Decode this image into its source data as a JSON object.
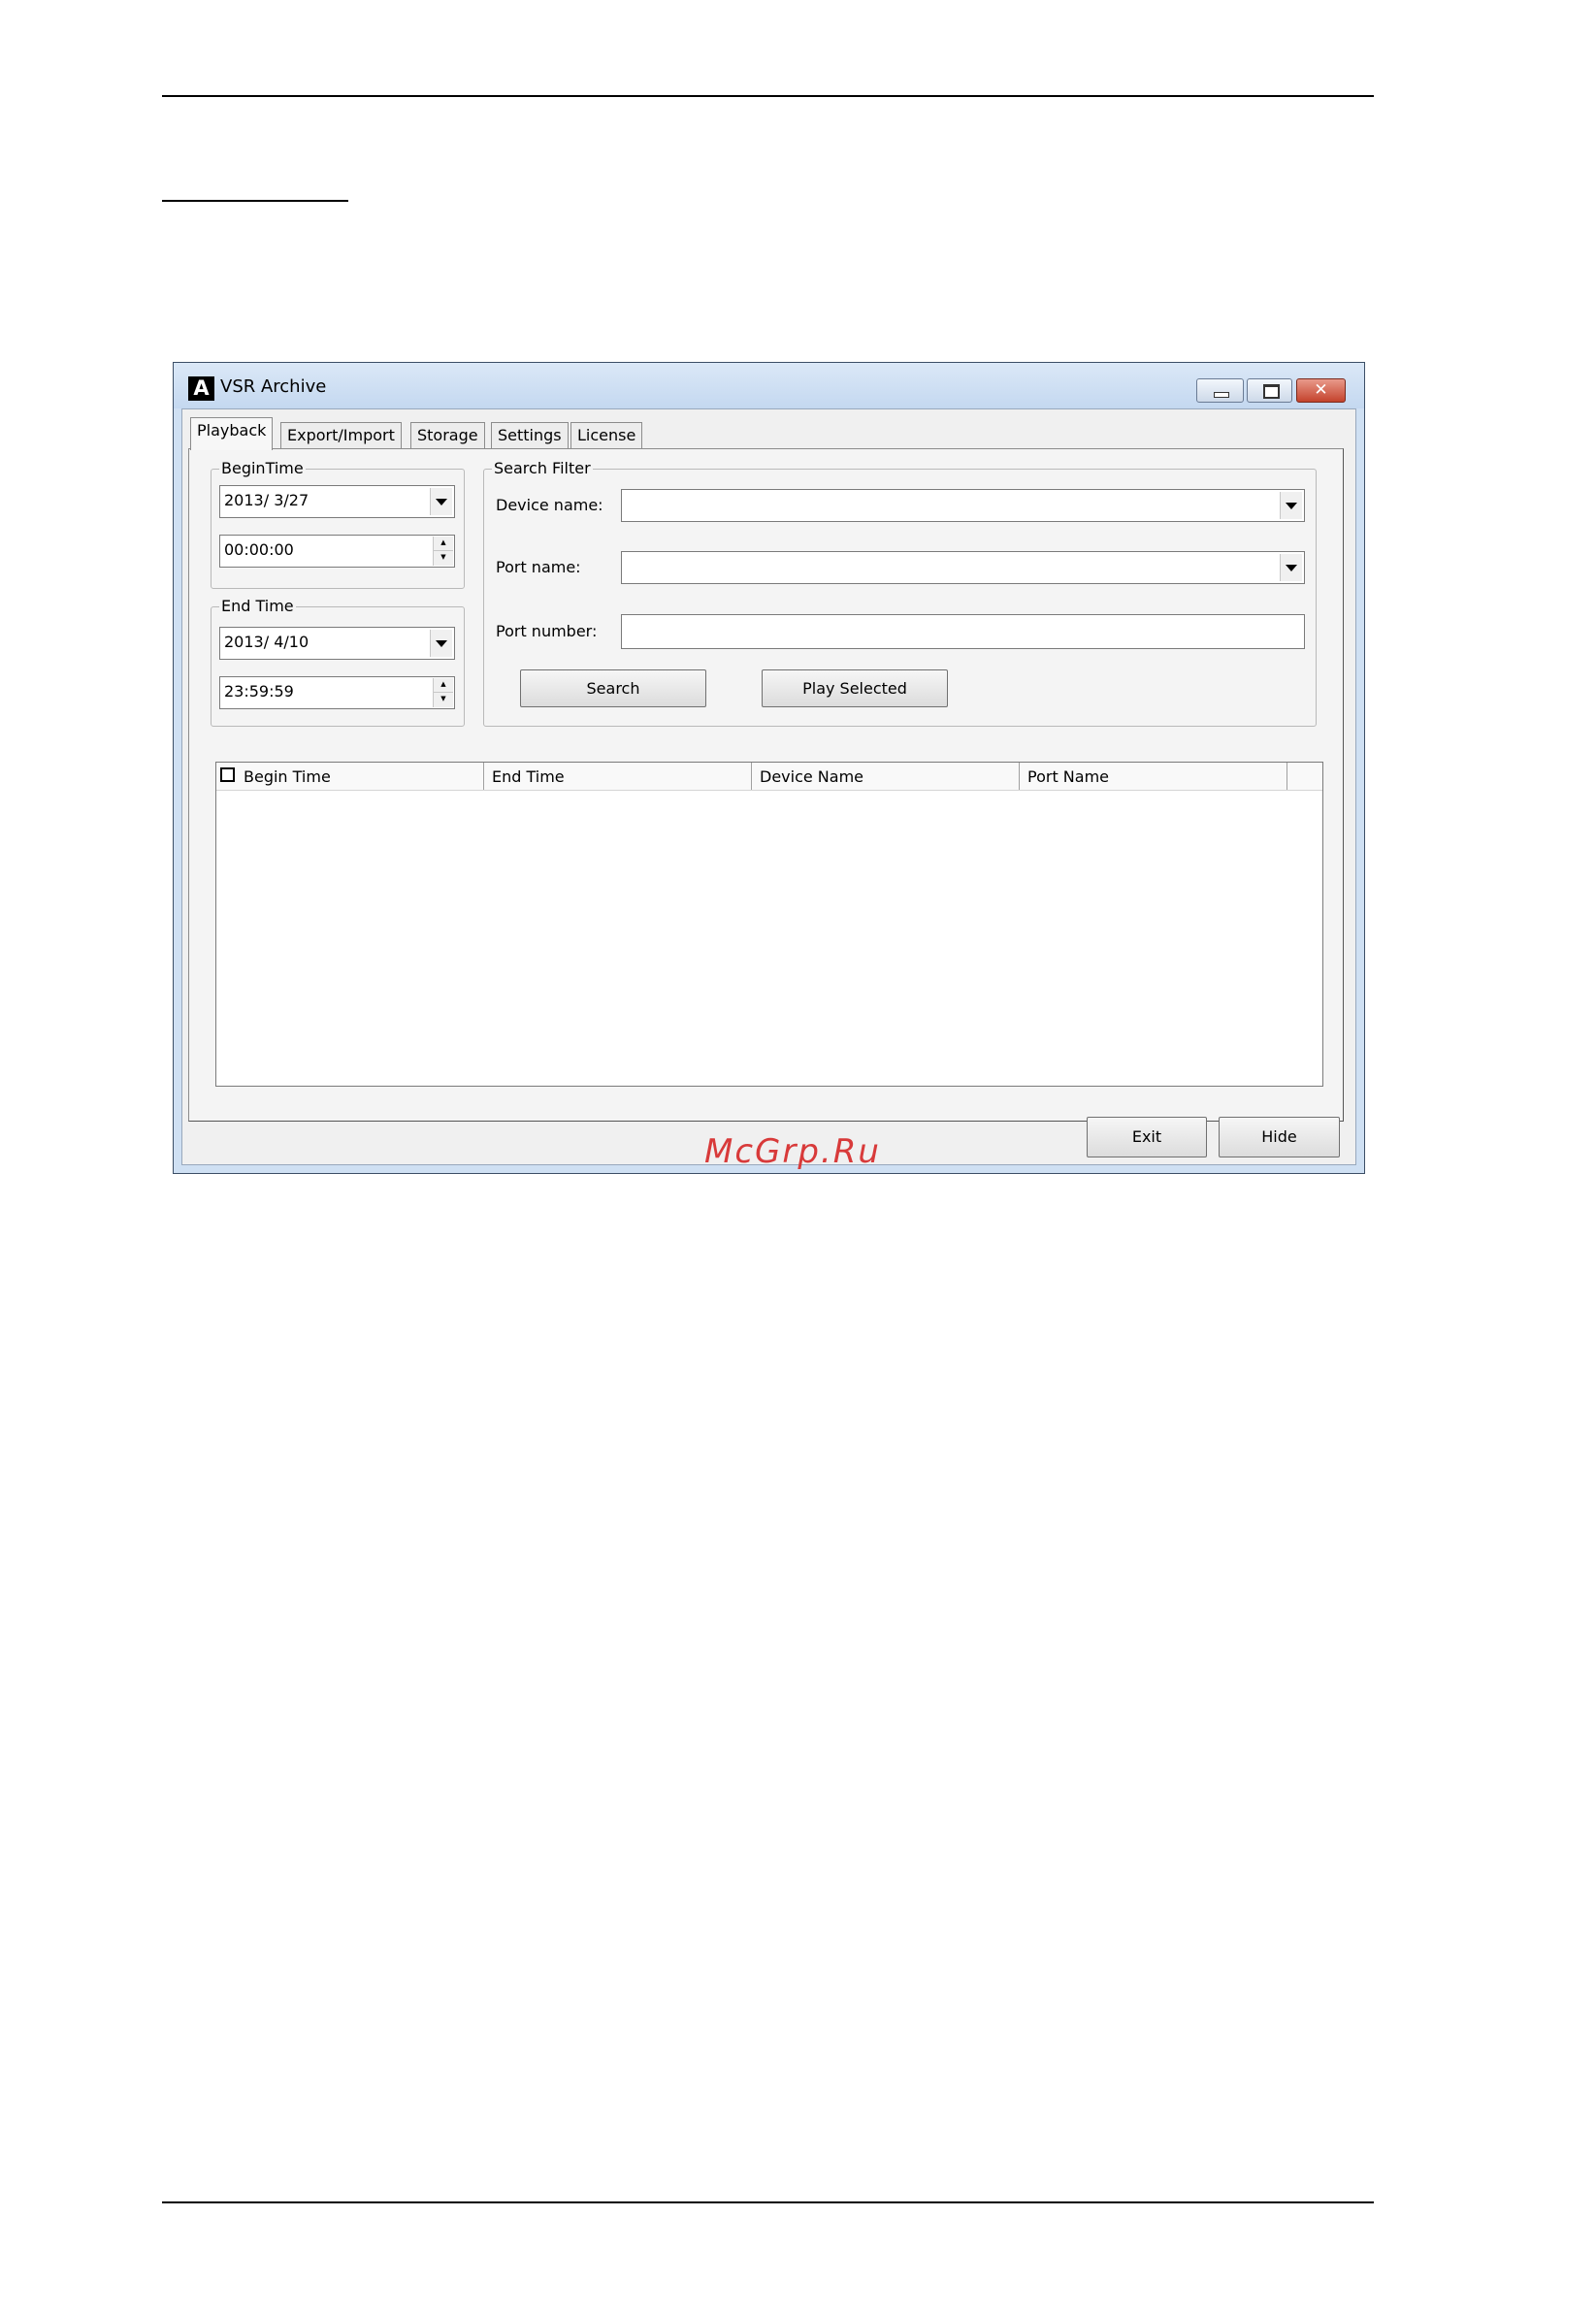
{
  "window": {
    "title": "VSR Archive",
    "logo_letter": "A",
    "controls": {
      "minimize": "minimize",
      "maximize": "maximize",
      "close": "✕"
    }
  },
  "tabs": [
    {
      "label": "Playback",
      "active": true
    },
    {
      "label": "Export/Import",
      "active": false
    },
    {
      "label": "Storage",
      "active": false
    },
    {
      "label": "Settings",
      "active": false
    },
    {
      "label": "License",
      "active": false
    }
  ],
  "begin_time": {
    "label": "BeginTime",
    "date": "2013/  3/27",
    "time": "00:00:00"
  },
  "end_time": {
    "label": "End Time",
    "date": "2013/  4/10",
    "time": "23:59:59"
  },
  "search_filter": {
    "label": "Search Filter",
    "device_name_label": "Device name:",
    "device_name_value": "",
    "port_name_label": "Port name:",
    "port_name_value": "",
    "port_number_label": "Port number:",
    "port_number_value": "",
    "search_button": "Search",
    "play_selected_button": "Play Selected"
  },
  "results": {
    "columns": [
      "Begin Time",
      "End Time",
      "Device Name",
      "Port Name"
    ],
    "rows": []
  },
  "footer": {
    "exit_button": "Exit",
    "hide_button": "Hide"
  },
  "watermark": "McGrp.Ru"
}
